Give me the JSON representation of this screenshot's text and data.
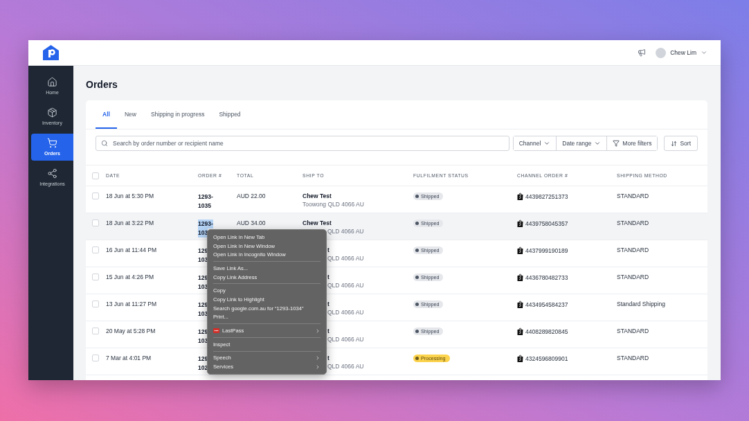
{
  "top_bar": {
    "user_name": "Chew Lim"
  },
  "sidebar": {
    "items": [
      {
        "label": "Home",
        "selected": false
      },
      {
        "label": "Inventory",
        "selected": false
      },
      {
        "label": "Orders",
        "selected": true
      },
      {
        "label": "Integrations",
        "selected": false
      }
    ]
  },
  "page_title": "Orders",
  "tabs": [
    {
      "label": "All",
      "selected": true
    },
    {
      "label": "New",
      "selected": false
    },
    {
      "label": "Shipping in progress",
      "selected": false
    },
    {
      "label": "Shipped",
      "selected": false
    }
  ],
  "search": {
    "placeholder": "Search by order number or recipient name"
  },
  "filters": [
    "Channel",
    "Date range",
    "More filters"
  ],
  "sort_button": "Sort",
  "table": {
    "header_checked": false,
    "columns": [
      "DATE",
      "ORDER #",
      "TOTAL",
      "SHIP TO",
      "FULFILMENT STATUS",
      "CHANNEL ORDER #",
      "SHIPPING METHOD"
    ],
    "rows": [
      {
        "checked": false,
        "selected": false,
        "date": "18 Jun at 5:30 PM",
        "order": [
          "1293-",
          "1035"
        ],
        "order_text_selected": false,
        "total": "AUD 22.00",
        "ship_name": "Chew Test",
        "ship_address": "Toowong QLD 4066 AU",
        "status": {
          "label": "Shipped",
          "kind": "shipped"
        },
        "channel_order": "4439827251373",
        "shipping_method": "STANDARD"
      },
      {
        "checked": false,
        "selected": true,
        "date": "18 Jun at 3:22 PM",
        "order": [
          "1293-",
          "103"
        ],
        "order_text_selected": true,
        "total": "AUD 34.00",
        "ship_name": "Chew Test",
        "ship_address_tail": "QLD 4066 AU",
        "status": {
          "label": "Shipped",
          "kind": "shipped"
        },
        "channel_order": "4439758045357",
        "shipping_method": "STANDARD"
      },
      {
        "checked": false,
        "selected": false,
        "date": "16 Jun at 11:44 PM",
        "order": [
          "129",
          "103"
        ],
        "order_text_selected": false,
        "ship_name_tail": "t",
        "ship_address_tail": "QLD 4066 AU",
        "status": {
          "label": "Shipped",
          "kind": "shipped"
        },
        "channel_order": "4437999190189",
        "shipping_method": "STANDARD"
      },
      {
        "checked": false,
        "selected": false,
        "date": "15 Jun at 4:26 PM",
        "order": [
          "129",
          "103"
        ],
        "order_text_selected": false,
        "ship_name_tail": "t",
        "ship_address_tail": "QLD 4066 AU",
        "status": {
          "label": "Shipped",
          "kind": "shipped"
        },
        "channel_order": "4436780482733",
        "shipping_method": "STANDARD"
      },
      {
        "checked": false,
        "selected": false,
        "date": "13 Jun at 11:27 PM",
        "order": [
          "129",
          "103"
        ],
        "order_text_selected": false,
        "ship_name_tail": "t",
        "ship_address_tail": "QLD 4066 AU",
        "status": {
          "label": "Shipped",
          "kind": "shipped"
        },
        "channel_order": "4434954584237",
        "shipping_method": "Standard Shipping"
      },
      {
        "checked": false,
        "selected": false,
        "date": "20 May at 5:28 PM",
        "order": [
          "129",
          "103"
        ],
        "order_text_selected": false,
        "ship_name_tail": "t",
        "ship_address_tail": "QLD 4066 AU",
        "status": {
          "label": "Shipped",
          "kind": "shipped"
        },
        "channel_order": "4408289820845",
        "shipping_method": "STANDARD"
      },
      {
        "checked": false,
        "selected": false,
        "date": "7 Mar at 4:01 PM",
        "order": [
          "129",
          "102"
        ],
        "order_text_selected": false,
        "ship_name_tail": "t",
        "ship_address_tail": "QLD 4066 AU",
        "status": {
          "label": "Processing",
          "kind": "processing"
        },
        "channel_order": "4324596809901",
        "shipping_method": "STANDARD"
      }
    ]
  },
  "context_menu": {
    "groups": [
      [
        {
          "label": "Open Link in New Tab",
          "kind": "command",
          "submenu": false
        },
        {
          "label": "Open Link in New Window",
          "kind": "command",
          "submenu": false
        },
        {
          "label": "Open Link in Incognito Window",
          "kind": "command",
          "submenu": false
        }
      ],
      [
        {
          "label": "Save Link As...",
          "kind": "command",
          "submenu": false
        },
        {
          "label": "Copy Link Address",
          "kind": "command",
          "submenu": false
        }
      ],
      [
        {
          "label": "Copy",
          "kind": "command",
          "submenu": false
        },
        {
          "label": "Copy Link to Highlight",
          "kind": "command",
          "submenu": false
        },
        {
          "label": "Search google.com.au for “1293-1034”",
          "kind": "command",
          "submenu": false
        },
        {
          "label": "Print...",
          "kind": "command",
          "submenu": false
        }
      ],
      [
        {
          "label": "LastPass",
          "kind": "extension",
          "submenu": true
        }
      ],
      [
        {
          "label": "Inspect",
          "kind": "command",
          "submenu": false
        }
      ],
      [
        {
          "label": "Speech",
          "kind": "command",
          "submenu": true
        },
        {
          "label": "Services",
          "kind": "command",
          "submenu": true
        }
      ]
    ]
  }
}
